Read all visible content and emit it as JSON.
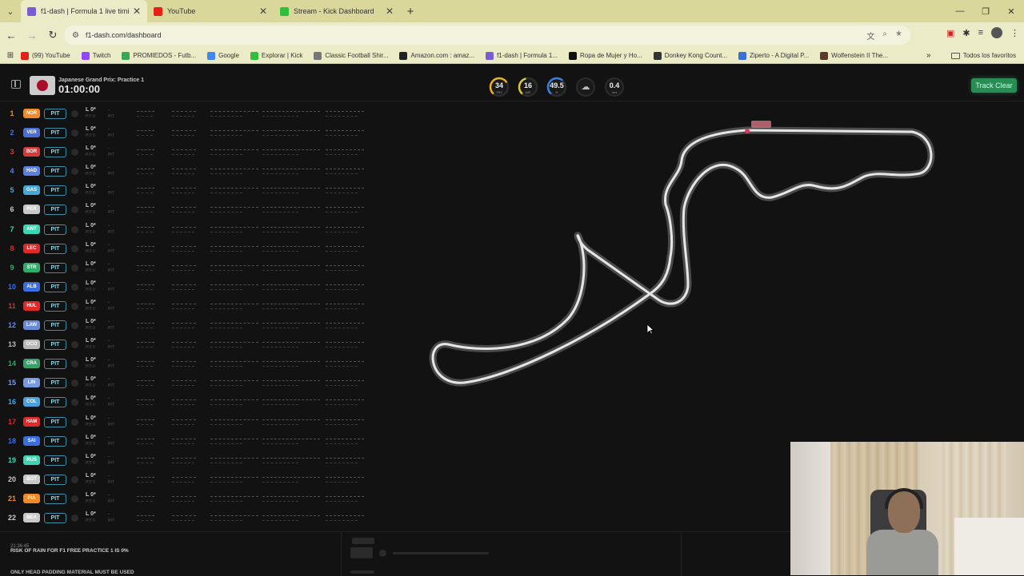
{
  "browser": {
    "tabs": [
      {
        "title": "f1-dash | Formula 1 live timing",
        "active": true,
        "favicon_color": "#7b5cd6"
      },
      {
        "title": "YouTube",
        "active": false,
        "favicon_color": "#e62117"
      },
      {
        "title": "Stream - Kick Dashboard",
        "active": false,
        "favicon_color": "#2fbf3a"
      }
    ],
    "url": "f1-dash.com/dashboard",
    "bookmarks": [
      {
        "label": "(99) YouTube",
        "color": "#e62117"
      },
      {
        "label": "Twitch",
        "color": "#9146ff"
      },
      {
        "label": "PROMIEDOS - Futb...",
        "color": "#3aa65a"
      },
      {
        "label": "Google",
        "color": "#4285f4"
      },
      {
        "label": "Explorar | Kick",
        "color": "#2fbf3a"
      },
      {
        "label": "Classic Football Shir...",
        "color": "#777777"
      },
      {
        "label": "Amazon.com : amaz...",
        "color": "#222222"
      },
      {
        "label": "f1-dash | Formula 1...",
        "color": "#7b5cd6"
      },
      {
        "label": "Ropa de Mujer y Ho...",
        "color": "#111111"
      },
      {
        "label": "Donkey Kong Count...",
        "color": "#333333"
      },
      {
        "label": "Ziperto - A Digital P...",
        "color": "#3a6fd6"
      },
      {
        "label": "Wolfenstein II The...",
        "color": "#5a3a2a"
      }
    ],
    "all_bookmarks": "Todos los favoritos"
  },
  "session": {
    "name": "Japanese Grand Prix: Practice 1",
    "timer": "01:00:00"
  },
  "weather": [
    {
      "value": "34",
      "label": "TRC",
      "color": "#e8b027",
      "fraction": 0.55
    },
    {
      "value": "16",
      "label": "AIR",
      "color": "#d8c93a",
      "fraction": 0.35
    },
    {
      "value": "49.5",
      "label": "H",
      "color": "#3a7fd8",
      "fraction": 0.5
    }
  ],
  "wind": {
    "value": "0.4",
    "label": "m/s"
  },
  "track_status": "Track Clear",
  "drivers": [
    {
      "pos": "1",
      "tla": "NOR",
      "color": "#f08a24"
    },
    {
      "pos": "2",
      "tla": "VER",
      "color": "#4a6ed6"
    },
    {
      "pos": "3",
      "tla": "BOR",
      "color": "#d63a3a"
    },
    {
      "pos": "4",
      "tla": "HAD",
      "color": "#5a7fe0"
    },
    {
      "pos": "5",
      "tla": "GAS",
      "color": "#45a6d8"
    },
    {
      "pos": "6",
      "tla": "PER",
      "color": "#c9c9c9"
    },
    {
      "pos": "7",
      "tla": "ANT",
      "color": "#3ad6b4"
    },
    {
      "pos": "8",
      "tla": "LEC",
      "color": "#e02a2a"
    },
    {
      "pos": "9",
      "tla": "STR",
      "color": "#2fae6a"
    },
    {
      "pos": "10",
      "tla": "ALB",
      "color": "#3a6ee0"
    },
    {
      "pos": "11",
      "tla": "HUL",
      "color": "#e02a2a"
    },
    {
      "pos": "12",
      "tla": "LAW",
      "color": "#6a8ad8"
    },
    {
      "pos": "13",
      "tla": "OCO",
      "color": "#b8b8b8"
    },
    {
      "pos": "14",
      "tla": "CRA",
      "color": "#3aa06a"
    },
    {
      "pos": "15",
      "tla": "LIN",
      "color": "#7a9ae0"
    },
    {
      "pos": "16",
      "tla": "COL",
      "color": "#4aa0d8"
    },
    {
      "pos": "17",
      "tla": "HAM",
      "color": "#e02a2a"
    },
    {
      "pos": "18",
      "tla": "SAI",
      "color": "#3a6ee0"
    },
    {
      "pos": "19",
      "tla": "RUS",
      "color": "#3ad6b4"
    },
    {
      "pos": "20",
      "tla": "BOT",
      "color": "#c9c9c9"
    },
    {
      "pos": "21",
      "tla": "PIA",
      "color": "#f08a24"
    },
    {
      "pos": "22",
      "tla": "BEA",
      "color": "#c9c9c9"
    }
  ],
  "row_texts": {
    "pit_label": "PIT",
    "lap_label": "L 0*",
    "lap_sub": "PIT 0",
    "gap": "-",
    "gap_sub": "PIT"
  },
  "race_control": {
    "time": "21:36:45",
    "message": "RISK OF RAIN FOR F1 FREE PRACTICE 1 IS 0%",
    "message2": "ONLY HEAD PADDING MATERIAL MUST BE USED"
  }
}
